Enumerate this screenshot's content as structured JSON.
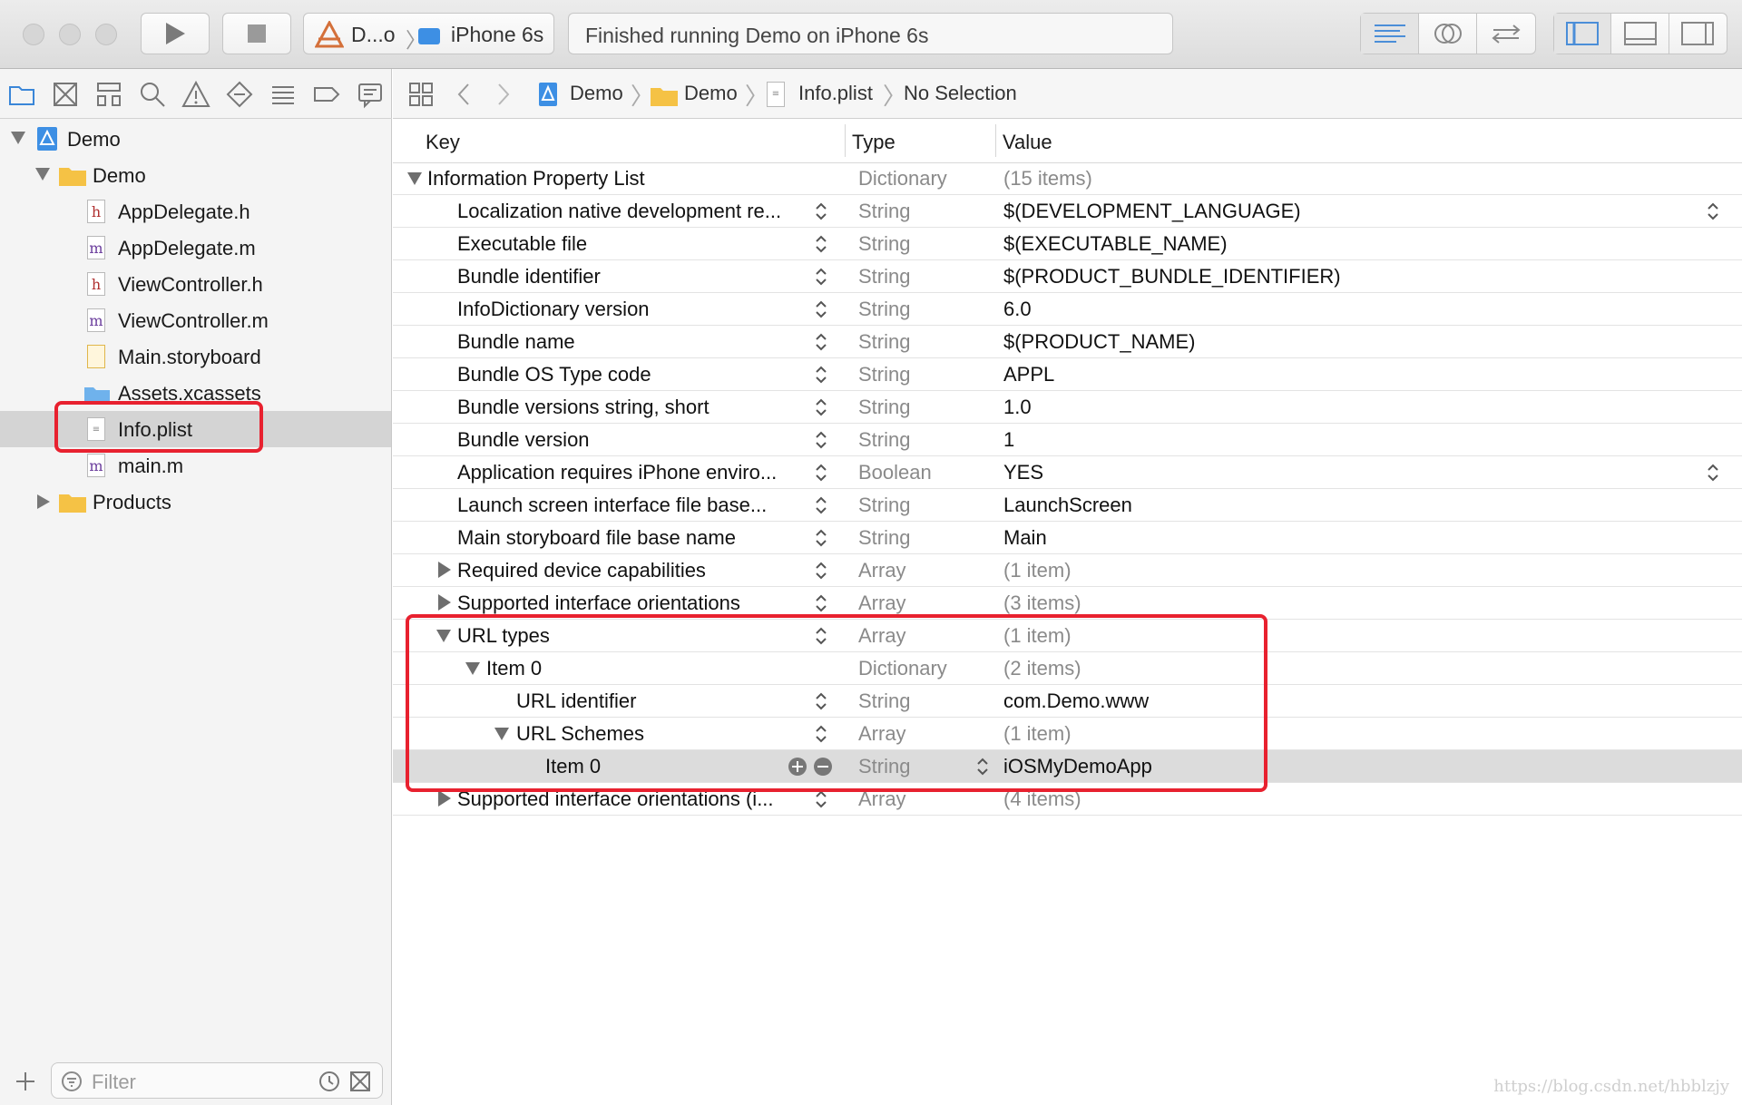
{
  "toolbar": {
    "scheme_target": "D...o",
    "scheme_device": "iPhone 6s",
    "activity_status": "Finished running Demo on iPhone 6s"
  },
  "navigator": {
    "items": [
      {
        "label": "Demo",
        "kind": "project",
        "depth": 0,
        "disclosure": "open"
      },
      {
        "label": "Demo",
        "kind": "folder",
        "depth": 1,
        "disclosure": "open"
      },
      {
        "label": "AppDelegate.h",
        "kind": "h",
        "depth": 2
      },
      {
        "label": "AppDelegate.m",
        "kind": "m",
        "depth": 2
      },
      {
        "label": "ViewController.h",
        "kind": "h",
        "depth": 2
      },
      {
        "label": "ViewController.m",
        "kind": "m",
        "depth": 2
      },
      {
        "label": "Main.storyboard",
        "kind": "storyboard",
        "depth": 2
      },
      {
        "label": "Assets.xcassets",
        "kind": "assets",
        "depth": 2
      },
      {
        "label": "Info.plist",
        "kind": "plist",
        "depth": 2,
        "selected": true
      },
      {
        "label": "main.m",
        "kind": "m",
        "depth": 2
      },
      {
        "label": "Products",
        "kind": "folder",
        "depth": 1,
        "disclosure": "closed"
      }
    ],
    "filter_placeholder": "Filter"
  },
  "jumpbar": {
    "crumbs": [
      "Demo",
      "Demo",
      "Info.plist",
      "No Selection"
    ]
  },
  "plist": {
    "headers": {
      "key": "Key",
      "type": "Type",
      "value": "Value"
    },
    "rows": [
      {
        "key": "Information Property List",
        "type": "Dictionary",
        "value": "(15 items)",
        "depth": 0,
        "disclosure": "open"
      },
      {
        "key": "Localization native development re...",
        "type": "String",
        "value": "$(DEVELOPMENT_LANGUAGE)",
        "depth": 1
      },
      {
        "key": "Executable file",
        "type": "String",
        "value": "$(EXECUTABLE_NAME)",
        "depth": 1
      },
      {
        "key": "Bundle identifier",
        "type": "String",
        "value": "$(PRODUCT_BUNDLE_IDENTIFIER)",
        "depth": 1
      },
      {
        "key": "InfoDictionary version",
        "type": "String",
        "value": "6.0",
        "depth": 1
      },
      {
        "key": "Bundle name",
        "type": "String",
        "value": "$(PRODUCT_NAME)",
        "depth": 1
      },
      {
        "key": "Bundle OS Type code",
        "type": "String",
        "value": "APPL",
        "depth": 1
      },
      {
        "key": "Bundle versions string, short",
        "type": "String",
        "value": "1.0",
        "depth": 1
      },
      {
        "key": "Bundle version",
        "type": "String",
        "value": "1",
        "depth": 1
      },
      {
        "key": "Application requires iPhone enviro...",
        "type": "Boolean",
        "value": "YES",
        "depth": 1
      },
      {
        "key": "Launch screen interface file base...",
        "type": "String",
        "value": "LaunchScreen",
        "depth": 1
      },
      {
        "key": "Main storyboard file base name",
        "type": "String",
        "value": "Main",
        "depth": 1
      },
      {
        "key": "Required device capabilities",
        "type": "Array",
        "value": "(1 item)",
        "depth": 1,
        "disclosure": "closed"
      },
      {
        "key": "Supported interface orientations",
        "type": "Array",
        "value": "(3 items)",
        "depth": 1,
        "disclosure": "closed"
      },
      {
        "key": "URL types",
        "type": "Array",
        "value": "(1 item)",
        "depth": 1,
        "disclosure": "open"
      },
      {
        "key": "Item 0",
        "type": "Dictionary",
        "value": "(2 items)",
        "depth": 2,
        "disclosure": "open"
      },
      {
        "key": "URL identifier",
        "type": "String",
        "value": "com.Demo.www",
        "depth": 3
      },
      {
        "key": "URL Schemes",
        "type": "Array",
        "value": "(1 item)",
        "depth": 3,
        "disclosure": "open"
      },
      {
        "key": "Item 0",
        "type": "String",
        "value": "iOSMyDemoApp",
        "depth": 4,
        "selected": true
      },
      {
        "key": "Supported interface orientations (i...",
        "type": "Array",
        "value": "(4 items)",
        "depth": 1,
        "disclosure": "closed"
      }
    ]
  },
  "watermark": "https://blog.csdn.net/hbblzjy",
  "colors": {
    "highlight": "#e8212f",
    "selection": "#dcdcdc",
    "folder": "#f5c245",
    "project_blue": "#3d8fe4"
  }
}
